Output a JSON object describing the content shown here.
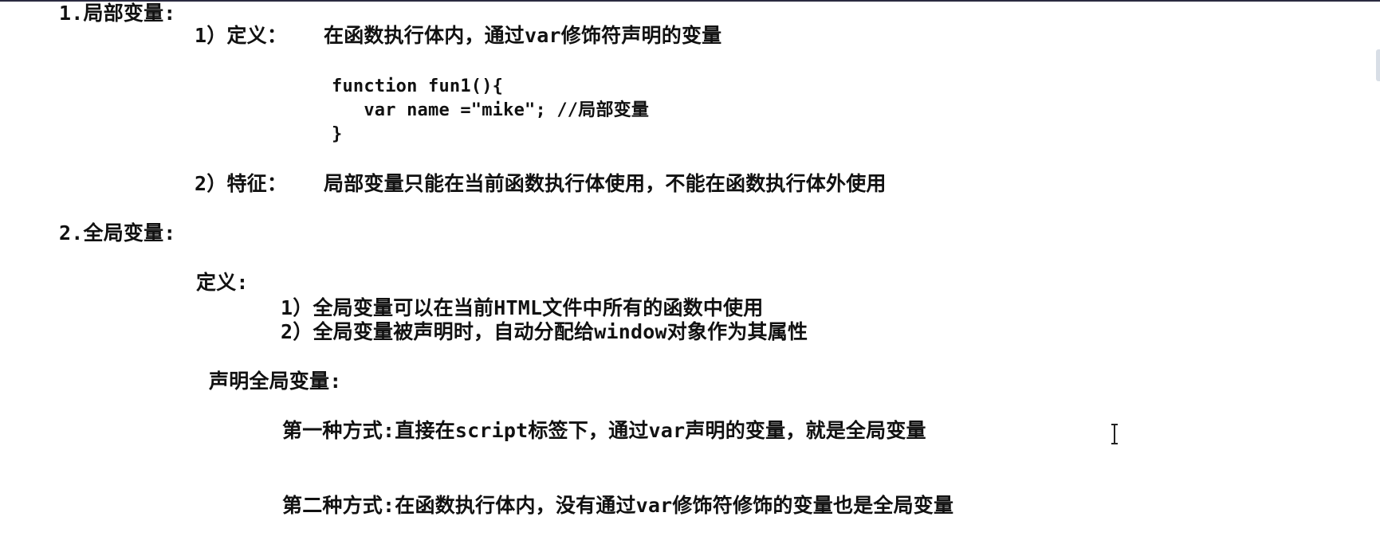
{
  "section1": {
    "heading": "1.局部变量:",
    "definition_label": "1）定义：",
    "definition_text": "在函数执行体内，通过var修饰符声明的变量",
    "code": [
      "function fun1(){",
      "   var name =\"mike\"; //局部变量",
      "}"
    ],
    "feature_label": "2）特征：",
    "feature_text": "局部变量只能在当前函数执行体使用，不能在函数执行体外使用"
  },
  "section2": {
    "heading": "2.全局变量:",
    "definition_label": "定义:",
    "definition_items": [
      "1）全局变量可以在当前HTML文件中所有的函数中使用",
      "2）全局变量被声明时，自动分配给window对象作为其属性"
    ],
    "declare_label": "声明全局变量:",
    "way1": "第一种方式:直接在script标签下，通过var声明的变量，就是全局变量",
    "way2": "第二种方式:在函数执行体内，没有通过var修饰符修饰的变量也是全局变量"
  }
}
